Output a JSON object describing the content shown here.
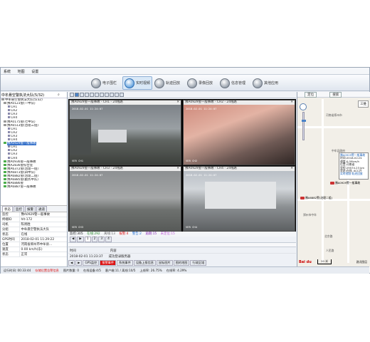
{
  "menu": [
    "系统",
    "地图",
    "设置"
  ],
  "toolbar": {
    "items": [
      {
        "label": "电子围栏"
      },
      {
        "label": "实时视频"
      },
      {
        "label": "轨迹回放"
      },
      {
        "label": "录像回放"
      },
      {
        "label": "信息管理"
      },
      {
        "label": "其他应用"
      }
    ]
  },
  "sidebar": {
    "search_value": "中牟悬空警执法大队(5/32)",
    "tree": [
      {
        "label": "中牟悬空警执法大队(5/32)",
        "icon": "folder"
      },
      {
        "label": "豫A0123警(一中队)",
        "icon": "car-gray"
      },
      {
        "label": "CH1",
        "icon": "cam"
      },
      {
        "label": "CH2",
        "icon": "cam"
      },
      {
        "label": "CH3",
        "icon": "cam"
      },
      {
        "label": "CH4",
        "icon": "cam"
      },
      {
        "label": "豫A0175警(七中队)",
        "icon": "car-gray"
      },
      {
        "label": "豫A6513警(治理三组)",
        "icon": "car-gray"
      },
      {
        "label": "CH1",
        "icon": "cam"
      },
      {
        "label": "CH2",
        "icon": "cam"
      },
      {
        "label": "CH3",
        "icon": "cam"
      },
      {
        "label": "CH4",
        "icon": "cam"
      },
      {
        "label": "豫A0929警一般事故",
        "icon": "car-g",
        "selected": true
      },
      {
        "label": "CH1",
        "icon": "cam"
      },
      {
        "label": "CH2",
        "icon": "cam"
      },
      {
        "label": "CH3",
        "icon": "cam"
      },
      {
        "label": "CH4",
        "icon": "cam"
      },
      {
        "label": "豫A0936警一般事故",
        "icon": "car-g"
      },
      {
        "label": "豫A2836警综合室",
        "icon": "car-g"
      },
      {
        "label": "豫A6372警(治理一组)",
        "icon": "car-g"
      },
      {
        "label": "豫A6873警(四中队)",
        "icon": "car-g"
      },
      {
        "label": "豫A6882警(治理二组)",
        "icon": "car-g"
      },
      {
        "label": "豫A6885警(勤务中队)",
        "icon": "car-g"
      },
      {
        "label": "豫A6886警",
        "icon": "car-g"
      },
      {
        "label": "豫A6887警一般事故",
        "icon": "car-g"
      }
    ],
    "tabs": [
      "状态",
      "监控",
      "报警",
      "通道"
    ],
    "info": [
      {
        "k": "监控",
        "v": "豫A0929警一般事故"
      },
      {
        "k": "终端ID",
        "v": "hlt-172"
      },
      {
        "k": "司机",
        "v": "陈周胜"
      },
      {
        "k": "分组",
        "v": "中牟悬空警执法大队"
      },
      {
        "k": "状态",
        "v": "在线"
      },
      {
        "k": "GPS时间",
        "v": "2018-02-01 11:29:22"
      },
      {
        "k": "位置",
        "v": "河南省郑州市中牟县..."
      },
      {
        "k": "速度",
        "v": "0.00 km/h(东)"
      },
      {
        "k": "状态",
        "v": "正常"
      }
    ]
  },
  "videos": [
    {
      "title": "1",
      "header": "豫A0929警一般事故 - CH1 - 24线路",
      "osd": "2018-02-01 11:24:07",
      "plate": "VER CH1"
    },
    {
      "title": "2",
      "header": "豫A0929警一般事故 - CH2 - 24线路",
      "osd": "2018-02-01 11:24:07",
      "plate": "VER CH2"
    },
    {
      "title": "3",
      "header": "豫A0929警一般事故 - CH3 - 24线路",
      "osd": "2018-02-01 11:24:07",
      "plate": "VER CH3"
    },
    {
      "title": "4",
      "header": "豫A0929警一般事故 - CH4 - 24线路",
      "osd": "2018-02-01 11:24:07",
      "plate": "VER CH4"
    }
  ],
  "status_strip": [
    "监控:305",
    "在线:292",
    "离线:13",
    "报警:4",
    "警告:2",
    "逾期:15",
    "未定位:15"
  ],
  "pager": [
    "1",
    "2",
    "3",
    "4"
  ],
  "log": {
    "columns": [
      "时间",
      "内容"
    ],
    "rows": [
      [
        "2018-02-01 11:23:37",
        "成功登录服务器"
      ]
    ]
  },
  "bottom_tabs": [
    {
      "label": "GPS监控",
      "alarm": false
    },
    {
      "label": "报警事件",
      "alarm": true
    },
    {
      "label": "系统事件",
      "alarm": false
    },
    {
      "label": "设备上报信息",
      "alarm": false
    },
    {
      "label": "鼠标图片",
      "alarm": false
    },
    {
      "label": "图的地图",
      "alarm": false
    },
    {
      "label": "行政区域",
      "alarm": false
    }
  ],
  "footer": [
    {
      "text": "运行时间: 00:33:44",
      "red": false
    },
    {
      "text": "存储位置告警信息",
      "red": true
    },
    {
      "text": "图片数量: 0",
      "red": false
    },
    {
      "text": "在线设备:4/5",
      "red": false
    },
    {
      "text": "客户端:11 / 离线:10/5",
      "red": false
    },
    {
      "text": "上线率: 26.75%",
      "red": false
    },
    {
      "text": "在线率: 4.29%",
      "red": false
    }
  ],
  "map": {
    "btn_locate": "定位",
    "btn_search": "搜索",
    "map_type": [
      "地图",
      "卫星",
      "三维"
    ],
    "infowin": [
      "豫A0929警一般事故",
      "时间:2018-02-01",
      "速度:0.00km/h",
      "位置:河南省",
      "里程:29574.23 km",
      "状态:在线, ACC开",
      "实时视频 轨迹回放"
    ],
    "vehicles": [
      "豫A0929警一般事故",
      "豫A6882警(治理二组)"
    ],
    "pois": [
      "河南省郑州市",
      "中牟县政府",
      "郑州市中牟",
      "北京路",
      "人民路"
    ],
    "scale": "20 米",
    "traffic": "路况图层",
    "copyright": "© 2018 Baidu - GS(2016)2089号 - 甲测资字1100930"
  }
}
